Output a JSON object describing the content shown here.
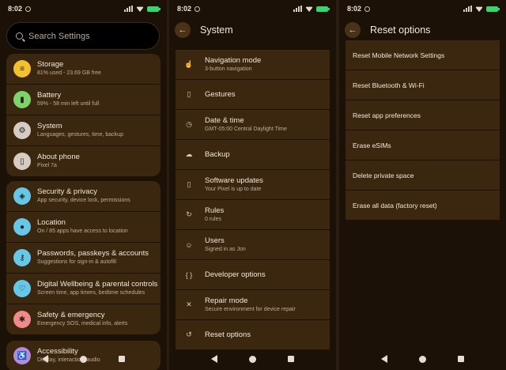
{
  "status": {
    "time": "8:02"
  },
  "panel1": {
    "search_placeholder": "Search Settings",
    "group1": [
      {
        "title": "Storage",
        "subtitle": "81% used - 23.69 GB free",
        "icon": "list-icon",
        "color": "#f2c12e",
        "glyph": "≡"
      },
      {
        "title": "Battery",
        "subtitle": "59% - 58 min left until full",
        "icon": "battery-icon",
        "color": "#7fd36b",
        "glyph": "▮"
      },
      {
        "title": "System",
        "subtitle": "Languages, gestures, time, backup",
        "icon": "gear-icon",
        "color": "#d6ccc2",
        "glyph": "⚙"
      },
      {
        "title": "About phone",
        "subtitle": "Pixel 7a",
        "icon": "phone-icon",
        "color": "#d6ccc2",
        "glyph": "▯"
      }
    ],
    "group2": [
      {
        "title": "Security & privacy",
        "subtitle": "App security, device lock, permissions",
        "icon": "shield-icon",
        "color": "#67c7e8",
        "glyph": "◈"
      },
      {
        "title": "Location",
        "subtitle": "On / 85 apps have access to location",
        "icon": "location-pin-icon",
        "color": "#67c7e8",
        "glyph": "●"
      },
      {
        "title": "Passwords, passkeys & accounts",
        "subtitle": "Suggestions for sign-in & autofill",
        "icon": "key-icon",
        "color": "#67c7e8",
        "glyph": "⚷"
      },
      {
        "title": "Digital Wellbeing & parental controls",
        "subtitle": "Screen time, app timers, bedtime schedules",
        "icon": "wellbeing-icon",
        "color": "#67c7e8",
        "glyph": "♡"
      },
      {
        "title": "Safety & emergency",
        "subtitle": "Emergency SOS, medical info, alerts",
        "icon": "emergency-icon",
        "color": "#f08a8a",
        "glyph": "✱"
      }
    ],
    "group3": [
      {
        "title": "Accessibility",
        "subtitle": "Display, interaction, audio",
        "icon": "accessibility-icon",
        "color": "#b48bd6",
        "glyph": "♿"
      }
    ]
  },
  "panel2": {
    "title": "System",
    "partial_header": "System",
    "items": [
      {
        "title": "Navigation mode",
        "subtitle": "3-button navigation",
        "icon": "gesture-hand-icon",
        "glyph": "☝"
      },
      {
        "title": "Gestures",
        "subtitle": "",
        "icon": "phone-gesture-icon",
        "glyph": "▯"
      },
      {
        "title": "Date & time",
        "subtitle": "GMT-05:00 Central Daylight Time",
        "icon": "clock-icon",
        "glyph": "◷"
      },
      {
        "title": "Backup",
        "subtitle": "",
        "icon": "cloud-upload-icon",
        "glyph": "☁"
      },
      {
        "title": "Software updates",
        "subtitle": "Your Pixel is up to date",
        "icon": "system-update-icon",
        "glyph": "▯"
      },
      {
        "title": "Rules",
        "subtitle": "0 rules",
        "icon": "rules-icon",
        "glyph": "↻"
      },
      {
        "title": "Users",
        "subtitle": "Signed in as Jon",
        "icon": "person-icon",
        "glyph": "☺"
      },
      {
        "title": "Developer options",
        "subtitle": "",
        "icon": "braces-icon",
        "glyph": "{ }"
      },
      {
        "title": "Repair mode",
        "subtitle": "Secure environment for device repair",
        "icon": "wrench-icon",
        "glyph": "✕"
      },
      {
        "title": "Reset options",
        "subtitle": "",
        "icon": "history-icon",
        "glyph": "↺"
      }
    ]
  },
  "panel3": {
    "title": "Reset options",
    "items": [
      "Reset Mobile Network Settings",
      "Reset Bluetooth & Wi-Fi",
      "Reset app preferences",
      "Erase eSIMs",
      "Delete private space",
      "Erase all data (factory reset)"
    ]
  },
  "icons": {
    "back": "←"
  }
}
